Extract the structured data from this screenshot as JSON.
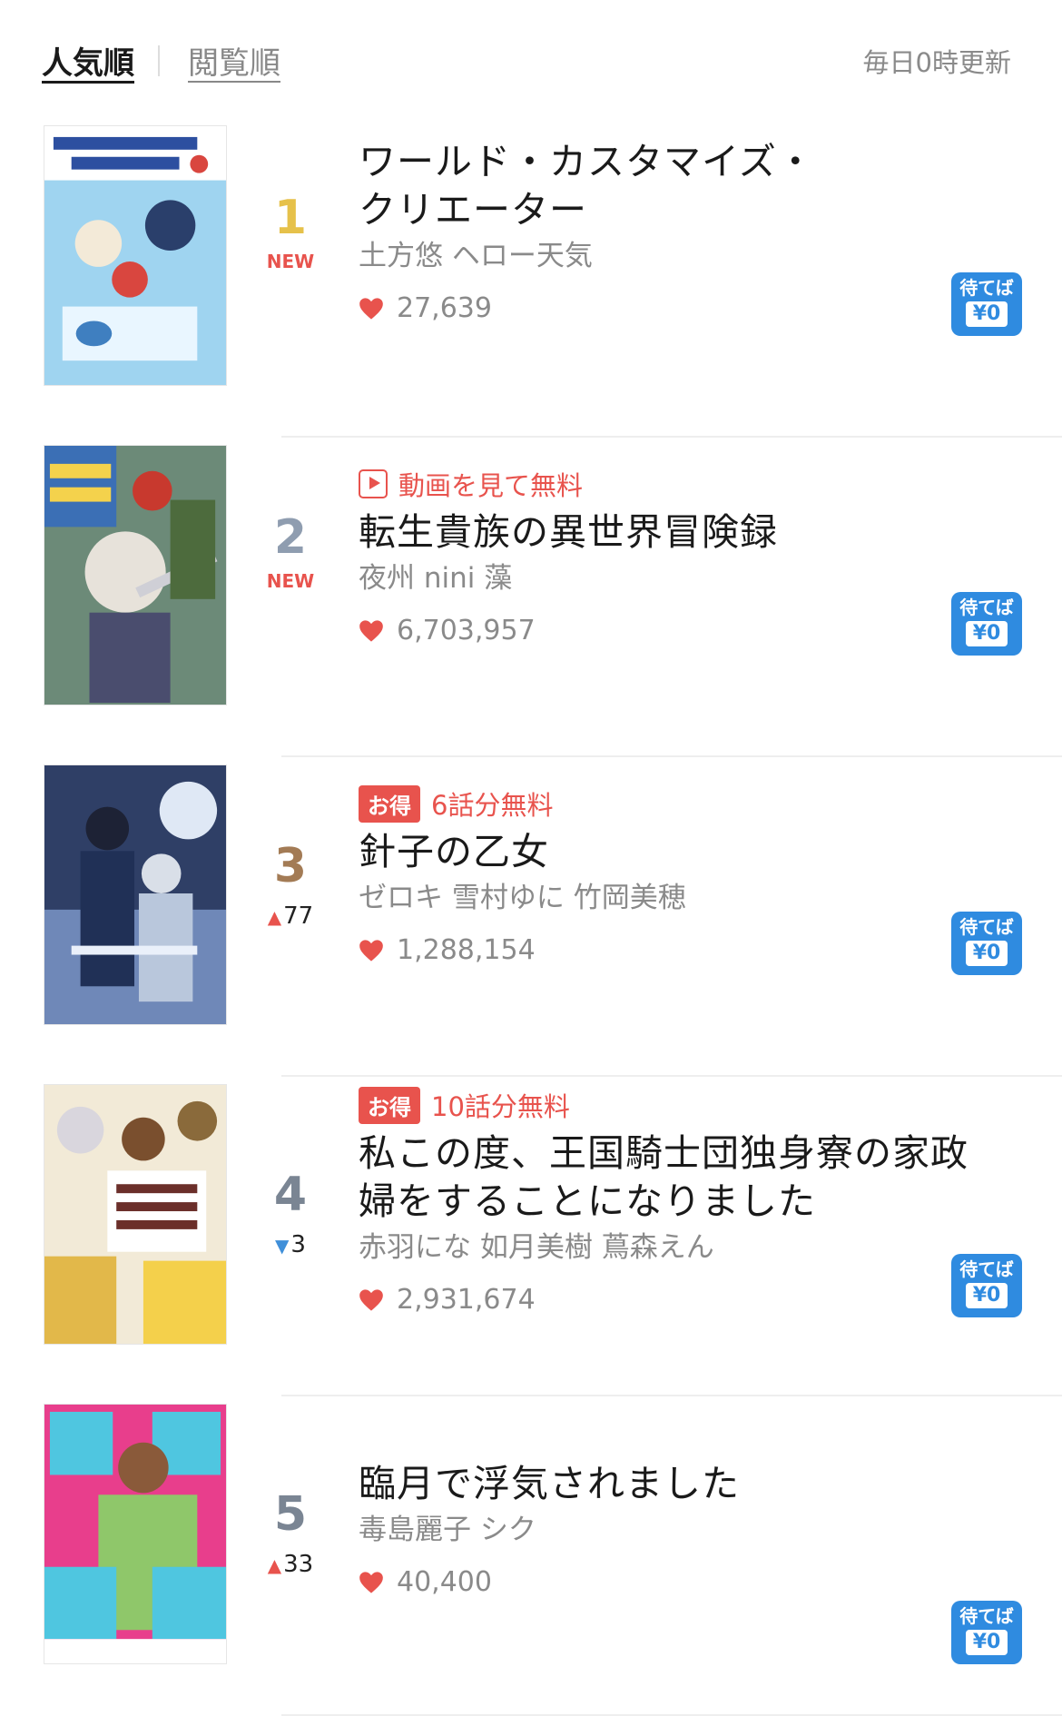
{
  "header": {
    "tab_popular": "人気順",
    "tab_views": "閲覧順",
    "update_note": "毎日0時更新"
  },
  "colors": {
    "accent_red": "#e8534d",
    "badge_blue": "#2f8be0",
    "rank_gold": "#e6c14a",
    "rank_silver": "#8f9db0",
    "rank_bronze": "#a37b55",
    "rank_gray": "#7a8593"
  },
  "items": [
    {
      "rank": "1",
      "rank_note": "NEW",
      "promo_type": "none",
      "promo_badge": "",
      "promo_text": "",
      "title": "ワールド・カスタマイズ・クリエーター",
      "authors": "土方悠 ヘロー天気",
      "likes": "27,639",
      "wait_top": "待てば",
      "wait_bottom": "¥0"
    },
    {
      "rank": "2",
      "rank_note": "NEW",
      "promo_type": "video",
      "promo_badge": "",
      "promo_text": "動画を見て無料",
      "title": "転生貴族の異世界冒険録",
      "authors": "夜州 nini 藻",
      "likes": "6,703,957",
      "wait_top": "待てば",
      "wait_bottom": "¥0"
    },
    {
      "rank": "3",
      "rank_change_dir": "up",
      "rank_change": "77",
      "promo_type": "otoku",
      "promo_badge": "お得",
      "promo_text": "6話分無料",
      "title": "針子の乙女",
      "authors": "ゼロキ 雪村ゆに 竹岡美穂",
      "likes": "1,288,154",
      "wait_top": "待てば",
      "wait_bottom": "¥0"
    },
    {
      "rank": "4",
      "rank_change_dir": "down",
      "rank_change": "3",
      "promo_type": "otoku",
      "promo_badge": "お得",
      "promo_text": "10話分無料",
      "title": "私この度、王国騎士団独身寮の家政婦をすることになりました",
      "authors": "赤羽にな 如月美樹 蔦森えん",
      "likes": "2,931,674",
      "wait_top": "待てば",
      "wait_bottom": "¥0"
    },
    {
      "rank": "5",
      "rank_change_dir": "up",
      "rank_change": "33",
      "promo_type": "none",
      "promo_badge": "",
      "promo_text": "",
      "title": "臨月で浮気されました",
      "authors": "毒島麗子 シク",
      "likes": "40,400",
      "wait_top": "待てば",
      "wait_bottom": "¥0"
    }
  ]
}
